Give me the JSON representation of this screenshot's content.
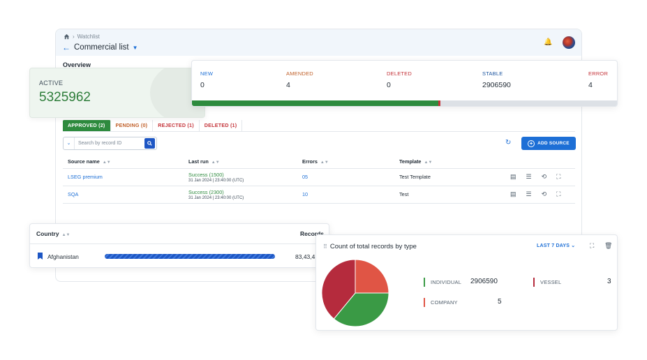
{
  "window": {
    "breadcrumb": "Watchlist",
    "title": "Commercial list",
    "overview": "Overview"
  },
  "active": {
    "label": "ACTIVE",
    "value": "5325962"
  },
  "stats": [
    {
      "key": "NEW",
      "value": "0",
      "color": "#1d6fd6"
    },
    {
      "key": "AMENDED",
      "value": "4",
      "color": "#c0602a"
    },
    {
      "key": "DELETED",
      "value": "0",
      "color": "#c4343a"
    },
    {
      "key": "STABLE",
      "value": "2906590",
      "color": "#1d56a0"
    },
    {
      "key": "ERROR",
      "value": "4",
      "color": "#c4343a"
    }
  ],
  "progress": {
    "green_fraction": 0.58,
    "red_fraction": 0.005
  },
  "tabs": {
    "approved": "APPROVED (2)",
    "pending": "PENDING (0)",
    "rejected": "REJECTED (1)",
    "deleted": "DELETED (1)"
  },
  "search": {
    "placeholder": "Search by record ID"
  },
  "add_source": "ADD SOURCE",
  "table": {
    "headers": [
      "Source name",
      "Last run",
      "Errors",
      "Template"
    ],
    "rows": [
      {
        "name": "LSEG premium",
        "status": "Success (1500)",
        "time": "31 Jan 2024 | 23:40:00 (UTC)",
        "errors": "05",
        "template": "Test Template"
      },
      {
        "name": "SQA",
        "status": "Success (2300)",
        "time": "31 Jan 2024 | 23:40:00 (UTC)",
        "errors": "10",
        "template": "Test"
      }
    ]
  },
  "country": {
    "header_country": "Country",
    "header_records": "Records",
    "row": {
      "name": "Afghanistan",
      "records": "83,43,4"
    }
  },
  "pie_card": {
    "title": "Count of total records by type",
    "range": "LAST 7 DAYS",
    "legend": [
      {
        "label": "INDIVIDUAL",
        "value": "2906590",
        "color": "#3a9a45"
      },
      {
        "label": "VESSEL",
        "value": "3",
        "color": "#b52b3d"
      },
      {
        "label": "COMPANY",
        "value": "5",
        "color": "#e05545"
      }
    ]
  },
  "chart_data": {
    "type": "pie",
    "title": "Count of total records by type",
    "slices": [
      {
        "label": "COMPANY",
        "value": 25,
        "color": "#e05545"
      },
      {
        "label": "INDIVIDUAL",
        "value": 36,
        "color": "#3a9a45"
      },
      {
        "label": "VESSEL",
        "value": 39,
        "color": "#b52b3d"
      }
    ]
  }
}
